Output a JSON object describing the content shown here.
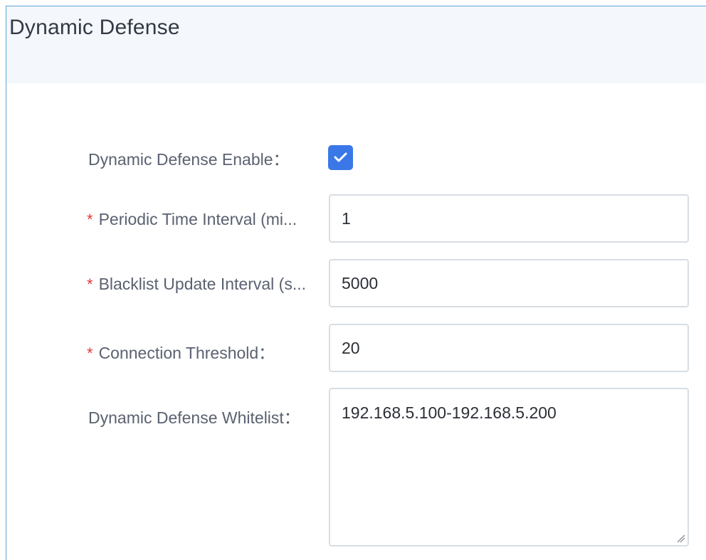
{
  "panel": {
    "title": "Dynamic Defense"
  },
  "form": {
    "enable": {
      "label": "Dynamic Defense Enable：",
      "checked": true
    },
    "periodic_interval": {
      "required_mark": "*",
      "label": "Periodic Time Interval (mi...",
      "value": "1"
    },
    "blacklist_interval": {
      "required_mark": "*",
      "label": "Blacklist Update Interval (s...",
      "value": "5000"
    },
    "connection_threshold": {
      "required_mark": "*",
      "label": "Connection Threshold：",
      "value": "20"
    },
    "whitelist": {
      "label": "Dynamic Defense Whitelist：",
      "value": "192.168.5.100-192.168.5.200"
    }
  },
  "icons": {
    "checkbox": "check-icon",
    "textarea_resize": "resize-grip-icon"
  },
  "colors": {
    "accent": "#3a78e8",
    "required": "#e03a3a",
    "panel_border": "#5aa7d9",
    "header_bg": "#f4f7fb"
  }
}
